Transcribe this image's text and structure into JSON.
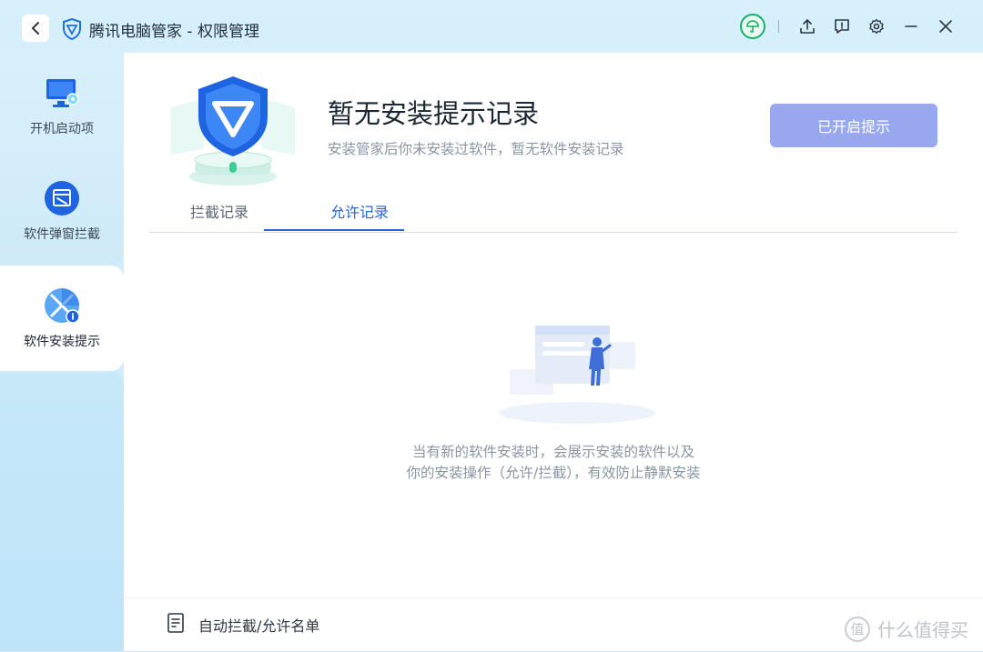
{
  "titlebar": {
    "title": "腾讯电脑管家 - 权限管理"
  },
  "sidebar": {
    "items": [
      {
        "label": "开机启动项",
        "icon": "monitor-icon"
      },
      {
        "label": "软件弹窗拦截",
        "icon": "popup-block-icon"
      },
      {
        "label": "软件安装提示",
        "icon": "install-tip-icon",
        "active": true
      }
    ]
  },
  "main": {
    "headline": "暂无安装提示记录",
    "subline": "安装管家后你未安装过软件，暂无软件安装记录",
    "primary_button": "已开启提示",
    "tabs": [
      {
        "label": "拦截记录"
      },
      {
        "label": "允许记录",
        "active": true
      }
    ],
    "empty_line1": "当有新的软件安装时，会展示安装的软件以及",
    "empty_line2": "你的安装操作（允许/拦截），有效防止静默安装",
    "footer_link": "自动拦截/允许名单"
  },
  "watermark": {
    "glyph": "值",
    "text": "什么值得买"
  },
  "colors": {
    "accent": "#2b64d8",
    "button_disabled": "#98a8ef",
    "health_green": "#16b169"
  }
}
